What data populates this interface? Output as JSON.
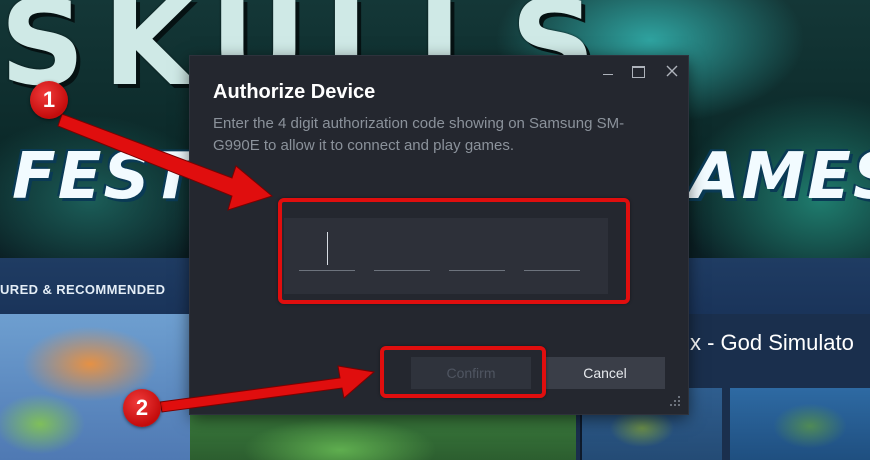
{
  "background": {
    "banner_title": "SKULLS",
    "festival_left": "FESTIV",
    "festival_right": "AMES",
    "nav_label": "URED & RECOMMENDED",
    "featured_game_title": "x - God Simulato"
  },
  "dialog": {
    "title": "Authorize Device",
    "description": "Enter the 4 digit authorization code showing on Samsung SM-G990E to allow it to connect and play games.",
    "code_digits": [
      "",
      "",
      "",
      ""
    ],
    "confirm_label": "Confirm",
    "cancel_label": "Cancel",
    "window_controls": [
      "minimize-icon",
      "maximize-icon",
      "close-icon"
    ]
  },
  "annotations": {
    "steps": [
      "1",
      "2"
    ],
    "highlight_color": "#e00e0e"
  },
  "colors": {
    "dialog_bg": "#24272f",
    "code_box_bg": "#2d3039",
    "cancel_bg": "#3a3e48",
    "confirm_bg": "#2f333c"
  }
}
